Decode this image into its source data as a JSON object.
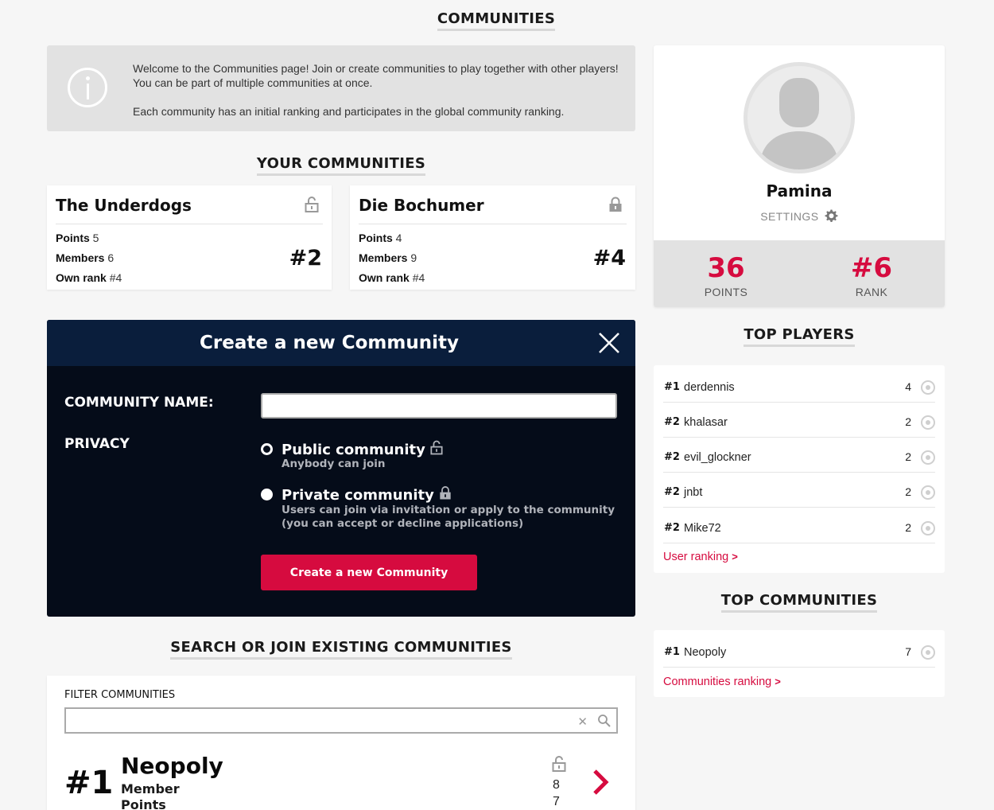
{
  "page": {
    "title": "COMMUNITIES"
  },
  "info": {
    "text1": "Welcome to the Communities page! Join or create communities to play together with other players! You can be part of multiple communities at once.",
    "text2": "Each community has an initial ranking and participates in the global community ranking."
  },
  "your_communities": {
    "title": "YOUR COMMUNITIES",
    "points_label": "Points",
    "members_label": "Members",
    "own_rank_label": "Own rank",
    "cards": [
      {
        "name": "The Underdogs",
        "points": "5",
        "members": "6",
        "own_rank": "#4",
        "rank": "#2",
        "lock": "open-lock-icon"
      },
      {
        "name": "Die Bochumer",
        "points": "4",
        "members": "9",
        "own_rank": "#4",
        "rank": "#4",
        "lock": "closed-lock-icon"
      }
    ]
  },
  "create": {
    "title": "Create a new Community",
    "name_label": "COMMUNITY NAME:",
    "name_value": "",
    "privacy_label": "PRIVACY",
    "public_title": "Public community",
    "public_sub": "Anybody can join",
    "private_title": "Private community",
    "private_sub": "Users can join via invitation or apply to the community (you can accept or decline applications)",
    "selected": "private",
    "button": "Create a new Community"
  },
  "search": {
    "title": "SEARCH OR JOIN EXISTING COMMUNITIES",
    "filter_label": "FILTER COMMUNITIES",
    "filter_value": "",
    "results": [
      {
        "rank": "#1",
        "name": "Neopoly",
        "member_label": "Member",
        "points_label": "Points",
        "members": "8",
        "points": "7"
      }
    ]
  },
  "profile": {
    "name": "Pamina",
    "settings": "SETTINGS",
    "points": "36",
    "points_label": "POINTS",
    "rank": "#6",
    "rank_label": "RANK"
  },
  "top_players": {
    "title": "TOP PLAYERS",
    "items": [
      {
        "rank": "#1",
        "name": "derdennis",
        "value": "4"
      },
      {
        "rank": "#2",
        "name": "khalasar",
        "value": "2"
      },
      {
        "rank": "#2",
        "name": "evil_glockner",
        "value": "2"
      },
      {
        "rank": "#2",
        "name": "jnbt",
        "value": "2"
      },
      {
        "rank": "#2",
        "name": "Mike72",
        "value": "2"
      }
    ],
    "link": "User ranking"
  },
  "top_communities": {
    "title": "TOP COMMUNITIES",
    "items": [
      {
        "rank": "#1",
        "name": "Neopoly",
        "value": "7"
      }
    ],
    "link": "Communities ranking"
  },
  "colors": {
    "accent": "#d60b3f",
    "modal_bg": "#050c19",
    "modal_header": "#0a1e3c",
    "page_bg": "#f6f6f6"
  }
}
